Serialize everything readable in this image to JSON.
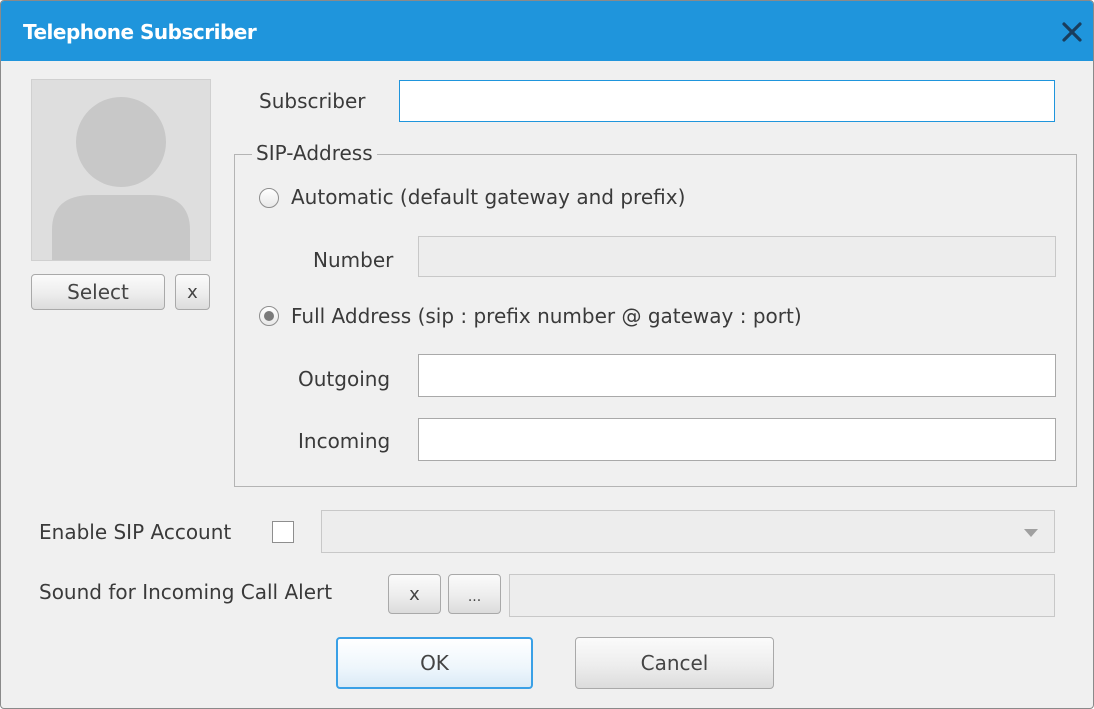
{
  "window": {
    "title": "Telephone Subscriber"
  },
  "photo": {
    "select_label": "Select",
    "clear_label": "x"
  },
  "subscriber": {
    "label": "Subscriber",
    "value": ""
  },
  "sip_address": {
    "group_label": "SIP-Address",
    "automatic_label": "Automatic (default gateway and prefix)",
    "automatic_selected": false,
    "number_label": "Number",
    "number_value": "",
    "full_address_label": "Full Address (sip : prefix number @ gateway : port)",
    "full_address_selected": true,
    "outgoing_label": "Outgoing",
    "outgoing_value": "",
    "incoming_label": "Incoming",
    "incoming_value": ""
  },
  "sip_account": {
    "label": "Enable SIP Account",
    "checked": false,
    "selected_value": ""
  },
  "sound": {
    "label": "Sound for Incoming Call Alert",
    "clear_label": "x",
    "browse_label": "...",
    "value": ""
  },
  "footer": {
    "ok_label": "OK",
    "cancel_label": "Cancel"
  },
  "colors": {
    "titlebar": "#1f95dc",
    "focus_border": "#1f95dc",
    "background": "#f0f0f0"
  }
}
